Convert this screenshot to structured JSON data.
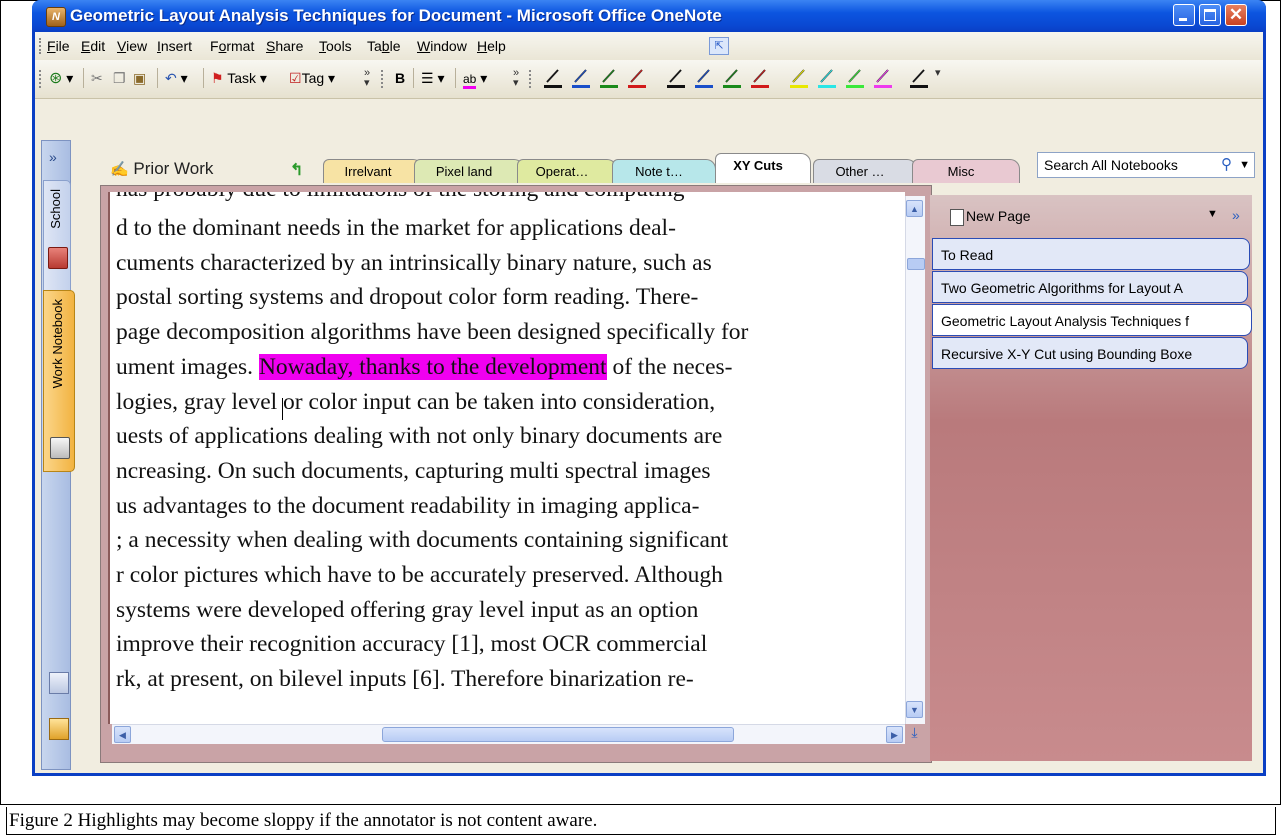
{
  "window": {
    "title": "Geometric Layout Analysis Techniques for Document  - Microsoft Office OneNote",
    "app_icon": "onenote-icon"
  },
  "menu": [
    {
      "pre": "",
      "key": "F",
      "post": "ile"
    },
    {
      "pre": "",
      "key": "E",
      "post": "dit"
    },
    {
      "pre": "",
      "key": "V",
      "post": "iew"
    },
    {
      "pre": "",
      "key": "I",
      "post": "nsert"
    },
    {
      "pre": "F",
      "key": "o",
      "post": "rmat"
    },
    {
      "pre": "",
      "key": "S",
      "post": "hare"
    },
    {
      "pre": "",
      "key": "T",
      "post": "ools"
    },
    {
      "pre": "Ta",
      "key": "b",
      "post": "le"
    },
    {
      "pre": "",
      "key": "W",
      "post": "indow"
    },
    {
      "pre": "",
      "key": "H",
      "post": "elp"
    }
  ],
  "toolbar": {
    "task_label": "Task",
    "tag_label": "Tag",
    "bold_label": "B",
    "highlight_label": "ab"
  },
  "pens": [
    "#111111",
    "#1a4fc9",
    "#1a8a1a",
    "#d11a1a",
    "#111111",
    "#1a4fc9",
    "#1a8a1a",
    "#d11a1a",
    "#e8e800",
    "#2ae6e6",
    "#3ae83a",
    "#ee3aee",
    "#111111"
  ],
  "notebooks": {
    "school": "School",
    "work": "Work Notebook",
    "expand": "»"
  },
  "section": {
    "title": "Prior Work"
  },
  "tabs": [
    {
      "label": "Irrelvant",
      "color": "#f7e3a4",
      "active": false
    },
    {
      "label": "Pixel land",
      "color": "#dde9b4",
      "active": false
    },
    {
      "label": "Operat…",
      "color": "#dfeaa0",
      "active": false
    },
    {
      "label": "Note t…",
      "color": "#b7e7ea",
      "active": false
    },
    {
      "label": "XY Cuts",
      "color": "#ffffff",
      "active": true
    },
    {
      "label": "Other …",
      "color": "#d9dce4",
      "active": false
    },
    {
      "label": "Misc",
      "color": "#e9c9d2",
      "active": false
    }
  ],
  "search": {
    "placeholder": "Search All Notebooks"
  },
  "document": {
    "lines": [
      {
        "pre": "d to the dominant needs in the market for applications deal-",
        "hl": "",
        "post": ""
      },
      {
        "pre": "cuments characterized by an intrinsically binary nature, such as",
        "hl": "",
        "post": ""
      },
      {
        "pre": "postal sorting systems and dropout color form reading.  There-",
        "hl": "",
        "post": ""
      },
      {
        "pre": "page decomposition algorithms have been designed specifically for",
        "hl": "",
        "post": ""
      },
      {
        "pre": "ument images. ",
        "hl": "Nowaday, thanks to the development",
        "post": " of the neces-"
      },
      {
        "pre": "logies, gray level or color input can be taken into consideration,",
        "hl": "",
        "post": ""
      },
      {
        "pre": "uests of applications dealing with not only binary documents are",
        "hl": "",
        "post": ""
      },
      {
        "pre": "ncreasing. On such documents, capturing multi spectral images",
        "hl": "",
        "post": ""
      },
      {
        "pre": "us advantages to the document readability in imaging applica-",
        "hl": "",
        "post": ""
      },
      {
        "pre": "; a necessity when dealing with documents containing significant",
        "hl": "",
        "post": ""
      },
      {
        "pre": "r color pictures which have to be accurately preserved. Although",
        "hl": "",
        "post": ""
      },
      {
        "pre": " systems were developed offering gray level input as an option",
        "hl": "",
        "post": ""
      },
      {
        "pre": " improve their recognition accuracy [1], most OCR commercial",
        "hl": "",
        "post": ""
      },
      {
        "pre": "rk, at present, on bilevel inputs [6].  Therefore binarization re-",
        "hl": "",
        "post": ""
      }
    ],
    "highlight_color": "#f000f0"
  },
  "pages": {
    "new_page_label": "New Page",
    "items": [
      {
        "label": "To Read",
        "selected": false
      },
      {
        "label": "Two Geometric Algorithms for Layout A",
        "selected": false
      },
      {
        "label": "Geometric Layout Analysis Techniques f",
        "selected": true
      },
      {
        "label": "Recursive X-Y Cut using Bounding Boxe",
        "selected": false
      }
    ]
  },
  "caption": "Figure 2 Highlights may become sloppy if the annotator is not content aware."
}
